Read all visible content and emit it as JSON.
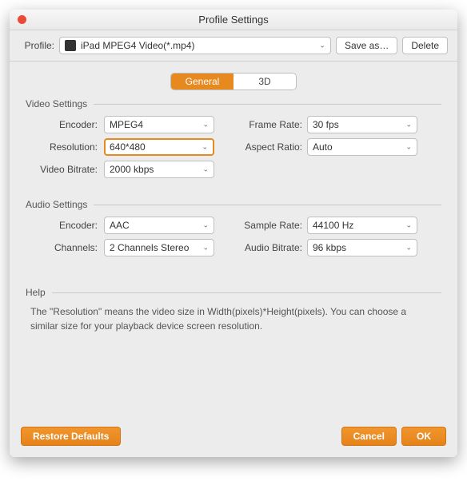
{
  "window": {
    "title": "Profile Settings"
  },
  "profile": {
    "label": "Profile:",
    "value": "iPad MPEG4 Video(*.mp4)",
    "saveAs": "Save as…",
    "delete": "Delete"
  },
  "tabs": {
    "general": "General",
    "threeD": "3D"
  },
  "video": {
    "title": "Video Settings",
    "encoderLabel": "Encoder:",
    "encoder": "MPEG4",
    "resolutionLabel": "Resolution:",
    "resolution": "640*480",
    "bitrateLabel": "Video Bitrate:",
    "bitrate": "2000 kbps",
    "frameRateLabel": "Frame Rate:",
    "frameRate": "30 fps",
    "aspectLabel": "Aspect Ratio:",
    "aspect": "Auto"
  },
  "audio": {
    "title": "Audio Settings",
    "encoderLabel": "Encoder:",
    "encoder": "AAC",
    "channelsLabel": "Channels:",
    "channels": "2 Channels Stereo",
    "sampleRateLabel": "Sample Rate:",
    "sampleRate": "44100 Hz",
    "bitrateLabel": "Audio Bitrate:",
    "bitrate": "96 kbps"
  },
  "help": {
    "title": "Help",
    "text": "The \"Resolution\" means the video size in Width(pixels)*Height(pixels).  You can choose a similar size for your playback device screen resolution."
  },
  "footer": {
    "restore": "Restore Defaults",
    "cancel": "Cancel",
    "ok": "OK"
  }
}
